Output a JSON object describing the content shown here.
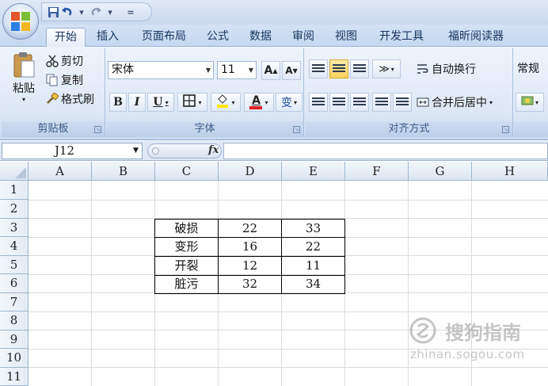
{
  "quick_access": {
    "save_icon": "save-icon",
    "undo_icon": "undo-icon",
    "redo_icon": "redo-icon",
    "customize": "="
  },
  "tabs": [
    {
      "label": "开始",
      "active": true
    },
    {
      "label": "插入"
    },
    {
      "label": "页面布局"
    },
    {
      "label": "公式"
    },
    {
      "label": "数据"
    },
    {
      "label": "审阅"
    },
    {
      "label": "视图"
    },
    {
      "label": "开发工具"
    },
    {
      "label": "福昕阅读器"
    }
  ],
  "clipboard": {
    "paste": "粘贴",
    "cut": "剪切",
    "copy": "复制",
    "format_painter": "格式刷",
    "label": "剪贴板"
  },
  "font": {
    "name": "宋体",
    "size": "11",
    "grow": "A",
    "shrink": "A",
    "bold": "B",
    "italic": "I",
    "underline": "U",
    "color_letter": "A",
    "phonetic": "变",
    "label": "字体"
  },
  "alignment": {
    "wrap": "自动换行",
    "merge": "合并后居中",
    "label": "对齐方式"
  },
  "number": {
    "format": "常规"
  },
  "formula_bar": {
    "cell_ref": "J12",
    "fx": "fx",
    "content": ""
  },
  "sheet": {
    "columns": [
      "A",
      "B",
      "C",
      "D",
      "E",
      "F",
      "G",
      "H"
    ],
    "rows": [
      "1",
      "2",
      "3",
      "4",
      "5",
      "6",
      "7",
      "8",
      "9",
      "10",
      "11"
    ],
    "table": [
      [
        "破损",
        "22",
        "33"
      ],
      [
        "变形",
        "16",
        "22"
      ],
      [
        "开裂",
        "12",
        "11"
      ],
      [
        "脏污",
        "32",
        "34"
      ]
    ]
  },
  "watermark": {
    "text": "搜狗指南",
    "url": "zhinan.sogou.com"
  },
  "colors": {
    "accent": "#15345f",
    "highlight_fill": "#ffd45e",
    "font_color_bar": "#e02020",
    "border": "#9eb6ce"
  }
}
